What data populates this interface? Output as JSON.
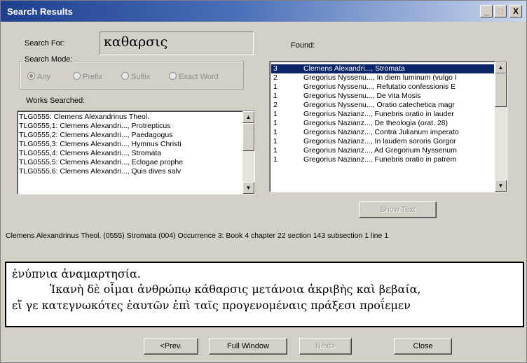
{
  "window": {
    "title": "Search Results"
  },
  "search": {
    "label": "Search For:",
    "value": "καθαρσις"
  },
  "mode": {
    "label": "Search Mode:",
    "options": [
      "Any",
      "Prefix",
      "Suffix",
      "Exact Word"
    ],
    "selected": "Any"
  },
  "works": {
    "label": "Works Searched:",
    "items": [
      "TLG0555:  Clemens Alexandrinus Theol.",
      "TLG0555,1: Clemens Alexandri..., Protrepticus",
      "TLG0555,2: Clemens Alexandri..., Paedagogus",
      "TLG0555,3: Clemens Alexandri..., Hymnus Christi",
      "TLG0555,4: Clemens Alexandri..., Stromata",
      "TLG0555,5: Clemens Alexandri..., Eclogae prophe",
      "TLG0555,6: Clemens Alexandri..., Quis dives salv"
    ]
  },
  "found": {
    "label": "Found:",
    "items": [
      {
        "count": "3",
        "text": "Clemens Alexandri..., Stromata",
        "selected": true
      },
      {
        "count": "2",
        "text": "Gregorius Nyssenu..., In diem luminum (vulgo I"
      },
      {
        "count": "1",
        "text": "Gregorius Nyssenu..., Refutatio confessionis E"
      },
      {
        "count": "1",
        "text": "Gregorius Nyssenu..., De vita Mosis"
      },
      {
        "count": "2",
        "text": "Gregorius Nyssenu..., Oratio catechetica magr"
      },
      {
        "count": "1",
        "text": "Gregorius Nazianz..., Funebris oratio in lauder"
      },
      {
        "count": "1",
        "text": "Gregorius Nazianz..., De theologia (orat. 28)"
      },
      {
        "count": "1",
        "text": "Gregorius Nazianz..., Contra Julianum imperato"
      },
      {
        "count": "1",
        "text": "Gregorius Nazianz..., In laudem sororis Gorgor"
      },
      {
        "count": "1",
        "text": "Gregorius Nazianz..., Ad Gregorium Nyssenum"
      },
      {
        "count": "1",
        "text": "Gregorius Nazianz..., Funebris oratio in patrem"
      }
    ]
  },
  "buttons": {
    "show_text": "Show Text",
    "prev": "<Prev.",
    "full_window": "Full Window",
    "next": "Next>",
    "close": "Close"
  },
  "citation": "Clemens Alexandrinus Theol. (0555) Stromata  (004) Occurrence 3: Book 4 chapter 22 section 143 subsection 1 line 1",
  "passage": {
    "lines": [
      "ἐνύπνια ἀναμαρτησία.",
      "Ἱκανὴ δὲ οἶμαι ἀνθρώπῳ κάθαρσις μετάνοια ἀκριβὴς καὶ βεβαία,",
      "εἴ γε κατεγνωκότες ἑαυτῶν ἐπὶ ταῖς προγενομέναις πράξεσι προΐεμεν"
    ]
  }
}
